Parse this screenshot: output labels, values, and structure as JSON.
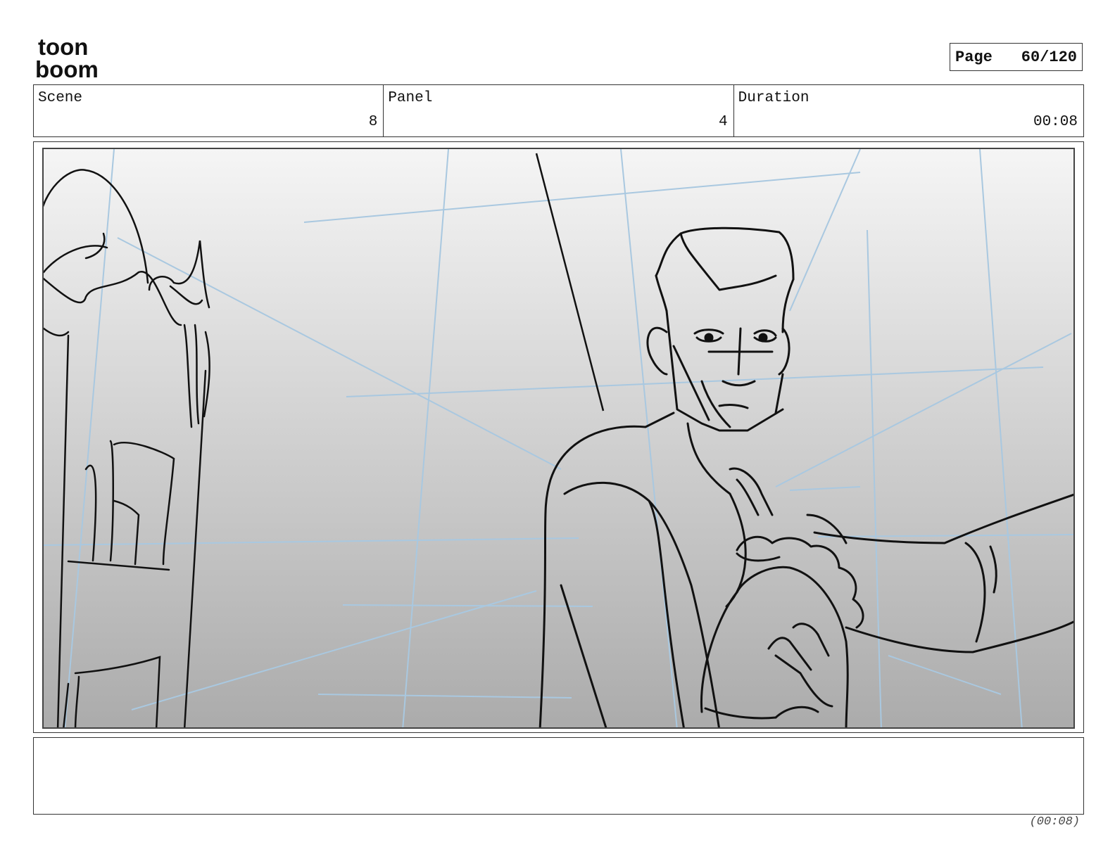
{
  "logo": {
    "line1": "toon",
    "line2": "boom"
  },
  "page": {
    "label": "Page",
    "value": "60/120"
  },
  "info": {
    "scene_label": "Scene",
    "scene_value": "8",
    "panel_label": "Panel",
    "panel_value": "4",
    "duration_label": "Duration",
    "duration_value": "00:08"
  },
  "panel_image": {
    "description_icon": "storyboard-sketch",
    "gradient_top": "#f5f5f5",
    "gradient_bottom": "#ababab",
    "guide_color": "#a9c8e0"
  },
  "notes": {
    "text": ""
  },
  "footer": {
    "duration": "(00:08)"
  }
}
